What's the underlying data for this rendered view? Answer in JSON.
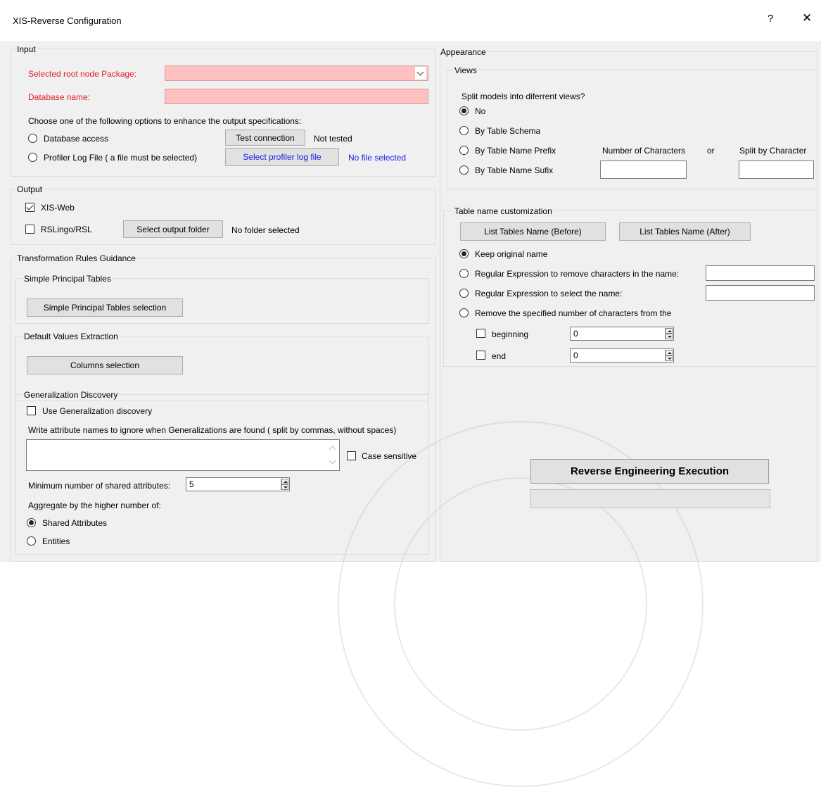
{
  "window": {
    "title": "XIS-Reverse Configuration",
    "help_label": "?",
    "close_label": "✕"
  },
  "input": {
    "legend": "Input",
    "root_node_label": "Selected root node Package:",
    "root_node_value": "",
    "db_name_label": "Database name:",
    "db_name_value": "",
    "options_text": "Choose one of the following options to enhance the output specifications:",
    "database_access_label": "Database access",
    "test_connection_label": "Test connection",
    "connection_status": "Not tested",
    "profiler_label": "Profiler Log File ( a file must be selected)",
    "select_profiler_label": "Select profiler log file",
    "profiler_status": "No file selected"
  },
  "output": {
    "legend": "Output",
    "xis_web_label": "XIS-Web",
    "xis_web_checked": true,
    "rslingo_label": "RSLingo/RSL",
    "rslingo_checked": false,
    "select_output_label": "Select output folder",
    "folder_status": "No folder selected"
  },
  "rules": {
    "legend": "Transformation Rules Guidance",
    "simple_legend": "Simple Principal Tables",
    "simple_button": "Simple Principal Tables selection",
    "default_legend": "Default Values Extraction",
    "columns_button": "Columns selection",
    "gen_legend": "Generalization Discovery",
    "use_gen_label": "Use Generalization discovery",
    "use_gen_checked": false,
    "ignore_text": "Write attribute names to ignore when Generalizations are found ( split by commas, without spaces)",
    "ignore_value": "",
    "case_sensitive_label": "Case sensitive",
    "min_shared_label": "Minimum number of shared attributes:",
    "min_shared_value": "5",
    "aggregate_label": "Aggregate by the higher number of:",
    "shared_attr_label": "Shared Attributes",
    "entities_label": "Entities",
    "aggregate_selected": "Shared Attributes"
  },
  "appearance": {
    "legend": "Appearance",
    "views_legend": "Views",
    "split_question": "Split models into diferrent views?",
    "no_label": "No",
    "by_schema_label": "By Table Schema",
    "by_prefix_label": "By Table Name Prefix",
    "by_sufix_label": "By Table Name Sufix",
    "views_selected": "No",
    "num_chars_label": "Number of Characters",
    "or_label": "or",
    "split_by_char_label": "Split by Character",
    "num_chars_value": "",
    "split_char_value": "",
    "table_legend": "Table name customization",
    "list_before_label": "List Tables Name (Before)",
    "list_after_label": "List Tables Name (After)",
    "keep_original_label": "Keep original name",
    "regex_remove_label": "Regular Expression to remove characters in the name:",
    "regex_select_label": "Regular Expression to select the name:",
    "remove_number_label": "Remove the specified number of characters from the",
    "table_selected": "Keep original name",
    "beginning_label": "beginning",
    "beginning_value": "0",
    "end_label": "end",
    "end_value": "0"
  },
  "execution": {
    "button_label": "Reverse Engineering Execution",
    "progress": 0
  }
}
